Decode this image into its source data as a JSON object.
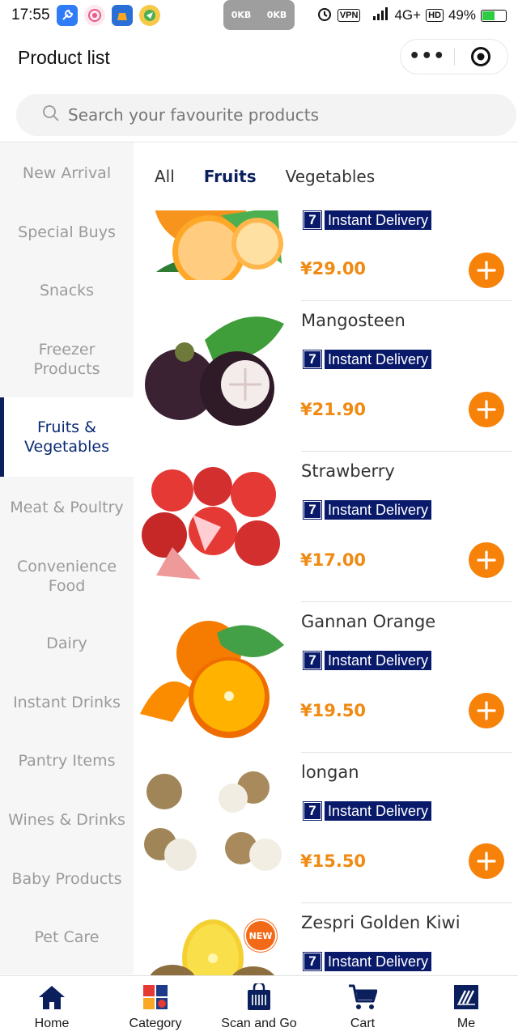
{
  "status_bar": {
    "time": "17:55",
    "speed_left": "0KB",
    "speed_right": "0KB",
    "vpn": "VPN",
    "network": "4G+",
    "hd": "HD",
    "battery": "49%",
    "battery_level": 0.49
  },
  "header": {
    "title": "Product list",
    "more_icon": "more-dots-icon",
    "close_icon": "target-icon"
  },
  "search": {
    "placeholder": "Search your favourite products"
  },
  "sidebar": {
    "categories": [
      {
        "label": "New Arrival"
      },
      {
        "label": "Special Buys"
      },
      {
        "label": "Snacks"
      },
      {
        "label": "Freezer Products"
      },
      {
        "label": "Fruits & Vegetables"
      },
      {
        "label": "Meat & Poultry"
      },
      {
        "label": "Convenience Food"
      },
      {
        "label": "Dairy"
      },
      {
        "label": "Instant Drinks"
      },
      {
        "label": "Pantry Items"
      },
      {
        "label": "Wines & Drinks"
      },
      {
        "label": "Baby Products"
      },
      {
        "label": "Pet Care"
      }
    ],
    "active_index": 4
  },
  "tabs": [
    {
      "label": "All"
    },
    {
      "label": "Fruits"
    },
    {
      "label": "Vegetables"
    }
  ],
  "products": [
    {
      "name": "",
      "badge_num": "7",
      "badge_text": "Instant Delivery",
      "price": "¥29.00"
    },
    {
      "name": "Mangosteen",
      "badge_num": "7",
      "badge_text": "Instant Delivery",
      "price": "¥21.90"
    },
    {
      "name": "Strawberry",
      "badge_num": "7",
      "badge_text": "Instant Delivery",
      "price": "¥17.00"
    },
    {
      "name": "Gannan Orange",
      "badge_num": "7",
      "badge_text": "Instant Delivery",
      "price": "¥19.50"
    },
    {
      "name": "longan",
      "badge_num": "7",
      "badge_text": "Instant Delivery",
      "price": "¥15.50"
    },
    {
      "name": "Zespri Golden Kiwi",
      "badge_num": "7",
      "badge_text": "Instant Delivery",
      "price": "",
      "tag": "NEW"
    }
  ],
  "bottom_nav": [
    {
      "label": "Home",
      "icon": "home-icon"
    },
    {
      "label": "Category",
      "icon": "category-icon"
    },
    {
      "label": "Scan and Go",
      "icon": "scan-bag-icon"
    },
    {
      "label": "Cart",
      "icon": "cart-icon"
    },
    {
      "label": "Me",
      "icon": "me-icon"
    }
  ],
  "colors": {
    "brand_navy": "#0a1f5c",
    "price_orange": "#f08a12",
    "add_button": "#f7820a"
  }
}
